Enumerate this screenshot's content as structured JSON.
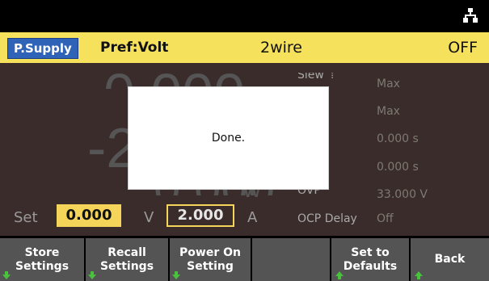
{
  "status": {
    "mode_button": "P.Supply",
    "priority": "Pref:Volt",
    "sense": "2wire",
    "output_state": "OFF"
  },
  "readings": {
    "voltage_partial": "0.000",
    "minus_digit": "-2",
    "power_partial": "0.000",
    "power_unit": "W"
  },
  "params": [
    {
      "label": "Slew",
      "value": "Max"
    },
    {
      "label": "",
      "value": "Max"
    },
    {
      "label": "",
      "value": "0.000 s"
    },
    {
      "label": "",
      "value": "0.000 s"
    },
    {
      "label": "OVP",
      "value": "33.000 V"
    },
    {
      "label": "OCP Delay",
      "value": "Off"
    }
  ],
  "setpoints": {
    "set_label": "Set",
    "voltage_value": "0.000",
    "voltage_unit": "V",
    "current_value": "2.000",
    "current_unit": "A"
  },
  "dialog": {
    "message": "Done."
  },
  "softkeys": [
    {
      "line1": "Store",
      "line2": "Settings",
      "arrow": "down"
    },
    {
      "line1": "Recall",
      "line2": "Settings",
      "arrow": "down"
    },
    {
      "line1": "Power On",
      "line2": "Setting",
      "arrow": "down"
    },
    {
      "line1": "",
      "line2": "",
      "arrow": ""
    },
    {
      "line1": "Set to",
      "line2": "Defaults",
      "arrow": "up"
    },
    {
      "line1": "Back",
      "line2": "",
      "arrow": "up"
    }
  ],
  "colors": {
    "status_bar": "#f6e15c",
    "mode_button": "#2f63b8",
    "main_bg": "#3a2c2a",
    "setpoint": "#f4d55a",
    "arrow_green": "#48c23a"
  },
  "icons": {
    "top_right": "network-icon"
  }
}
